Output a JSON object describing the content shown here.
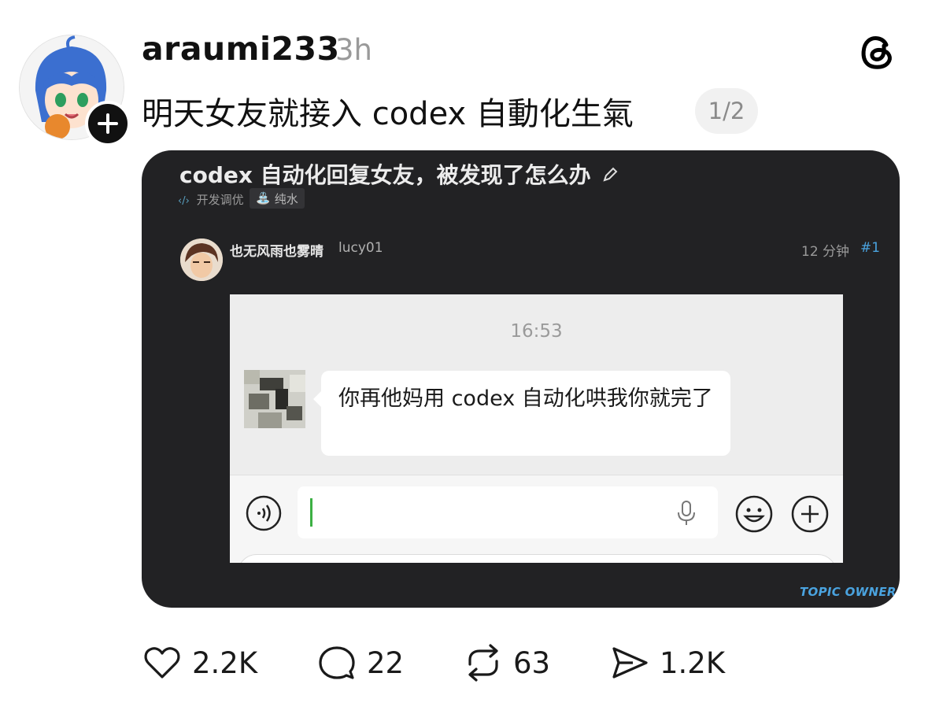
{
  "post": {
    "username": "araumi233",
    "timestamp": "3h",
    "text": "明天女友就接入 codex 自動化生氣",
    "page_indicator": "1/2"
  },
  "card": {
    "forum_title": "codex 自动化回复女友，被发现了怎么办",
    "tags": [
      "开发调优",
      "纯水"
    ],
    "poster_name": "也无风雨也雾晴",
    "poster_handle": "lucy01",
    "post_time": "12 分钟",
    "post_number": "#1",
    "footer_label": "TOPIC OWNER",
    "chat": {
      "time": "16:53",
      "message": "你再他妈用 codex 自动化哄我你就完了"
    }
  },
  "actions": {
    "likes": "2.2K",
    "comments": "22",
    "reposts": "63",
    "shares": "1.2K"
  },
  "icons": {
    "follow": "plus-icon",
    "brand": "threads-logo",
    "edit": "pencil-icon",
    "like": "heart-icon",
    "comment": "comment-bubble-icon",
    "repost": "repost-icon",
    "share": "send-icon"
  },
  "colors": {
    "card_bg": "#222224",
    "accent_blue": "#4aa3df",
    "cursor_green": "#3cb043"
  }
}
